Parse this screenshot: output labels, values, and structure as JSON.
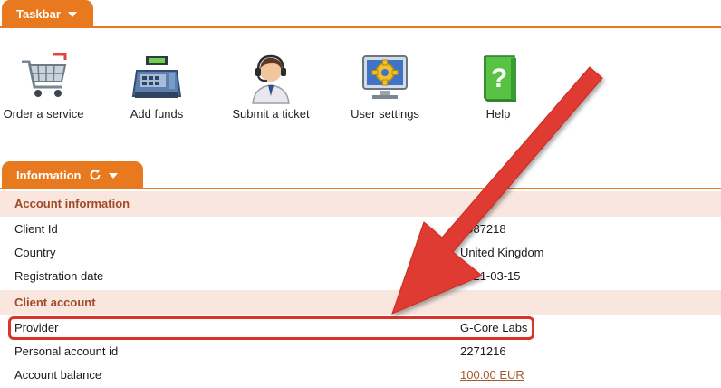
{
  "taskbar": {
    "title": "Taskbar",
    "items": [
      {
        "label": "Order a service",
        "icon": "shopping-cart-icon"
      },
      {
        "label": "Add funds",
        "icon": "cash-register-icon"
      },
      {
        "label": "Submit a ticket",
        "icon": "support-agent-icon"
      },
      {
        "label": "User settings",
        "icon": "settings-monitor-icon"
      },
      {
        "label": "Help",
        "icon": "help-book-icon"
      }
    ]
  },
  "information": {
    "title": "Information",
    "sections": [
      {
        "title": "Account information",
        "rows": [
          {
            "key": "Client Id",
            "value": "1987218"
          },
          {
            "key": "Country",
            "value": "United Kingdom"
          },
          {
            "key": "Registration date",
            "value": "2021-03-15"
          }
        ]
      },
      {
        "title": "Client account",
        "rows": [
          {
            "key": "Provider",
            "value": "G-Core Labs"
          },
          {
            "key": "Personal account id",
            "value": "2271216"
          },
          {
            "key": "Account balance",
            "value": "100.00 EUR"
          }
        ]
      }
    ]
  },
  "colors": {
    "accent": "#e8791f",
    "section_bg": "#f8e6df",
    "section_text": "#a04a26",
    "annotation": "#d9342b"
  }
}
